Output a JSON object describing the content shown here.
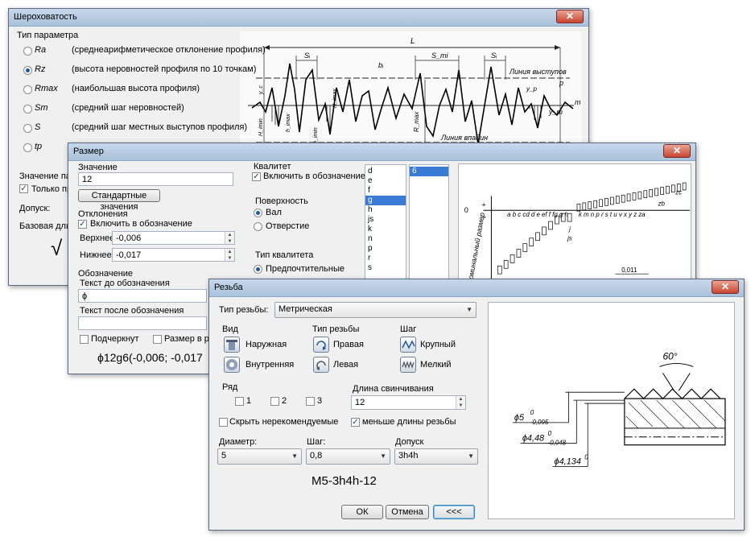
{
  "roughness": {
    "title": "Шероховатость",
    "section_label": "Тип параметра",
    "params": [
      {
        "code": "Ra",
        "desc": "(среднеарифметическое отклонение профиля)",
        "selected": false
      },
      {
        "code": "Rz",
        "desc": "(высота неровностей профиля по 10 точкам)",
        "selected": true
      },
      {
        "code": "Rmax",
        "desc": "(наибольшая высота профиля)",
        "selected": false
      },
      {
        "code": "Sm",
        "desc": "(средний шаг неровностей)",
        "selected": false
      },
      {
        "code": "S",
        "desc": "(средний шаг местных выступов профиля)",
        "selected": false
      },
      {
        "code": "tp",
        "desc": "",
        "selected": false
      }
    ],
    "value_label": "Значение пара",
    "only_label": "Только пред",
    "tolerance_label": "Допуск:",
    "base_length_label": "Базовая длина",
    "check_symbol": "√",
    "diagram": {
      "L": "L",
      "S_i_left": "Sᵢ",
      "S_i_right": "Sᵢ",
      "b_i": "bᵢ",
      "S_mi": "S_mi",
      "peak_line": "Линия выступов",
      "valley_line": "Линия впадин",
      "p": "p",
      "m": "m",
      "y_m": "y_m",
      "y_p": "y_p",
      "R_max": "R_max",
      "y_c": "y_c",
      "H_max": "H_imax",
      "H_min": "H_imin",
      "h_max": "h_imax",
      "h_min": "h_imin"
    }
  },
  "size": {
    "title": "Размер",
    "value_label": "Значение",
    "value": "12",
    "standard_values_btn": "Стандартные значения",
    "deviations_label": "Отклонения",
    "include_in_designation": "Включить в обозначение",
    "upper_label": "Верхнее",
    "upper_value": "-0,006",
    "lower_label": "Нижнее",
    "lower_value": "-0,017",
    "designation_label": "Обозначение",
    "text_before_label": "Текст до обозначения",
    "text_before_value": "ϕ",
    "text_after_label": "Текст после обозначения",
    "underlined_label": "Подчеркнут",
    "frame_label": "Размер в рамк",
    "result": "ϕ12g6(-0,006; -0,017",
    "qualitet_label": "Квалитет",
    "qualitet_include": "Включить в обозначение",
    "surface_label": "Поверхность",
    "shaft_label": "Вал",
    "hole_label": "Отверстие",
    "qualitet_type_label": "Тип квалитета",
    "preferred_label": "Предпочтительные",
    "letters": [
      "d",
      "e",
      "f",
      "g",
      "h",
      "js",
      "k",
      "n",
      "p",
      "r",
      "s"
    ],
    "letters_selected": "g",
    "grades": [
      "6"
    ],
    "grade_selected": "6",
    "chart": {
      "zero": "0",
      "plus": "+",
      "minus": "−",
      "axis_label": "номинальный размер",
      "letters_top": "a b c cd d e ef f fg g h",
      "letters_mid": "k m n p r s t u v x y z za",
      "zb": "zb",
      "zc": "zc",
      "j": "j",
      "js": "js",
      "value_label": "0,011"
    }
  },
  "thread": {
    "title": "Резьба",
    "type_label": "Тип резьбы:",
    "type_value": "Метрическая",
    "view_label": "Вид",
    "outer_label": "Наружная",
    "inner_label": "Внутренняя",
    "thread_type_label": "Тип резьбы",
    "right_label": "Правая",
    "left_label": "Левая",
    "pitch_group_label": "Шаг",
    "coarse_label": "Крупный",
    "fine_label": "Мелкий",
    "row_label": "Ряд",
    "rows": [
      "1",
      "2",
      "3"
    ],
    "length_label": "Длина свинчивания",
    "length_value": "12",
    "hide_label": "Скрыть нерекомендуемые",
    "less_label": "меньше длины резьбы",
    "diameter_label": "Диаметр:",
    "diameter_value": "5",
    "pitch_label": "Шаг:",
    "pitch_value": "0,8",
    "tolerance_label": "Допуск",
    "tolerance_value": "3h4h",
    "result": "M5-3h4h-12",
    "ok": "ОК",
    "cancel": "Отмена",
    "back": "<<<",
    "drawing": {
      "angle": "60°",
      "d1_main": "ϕ5",
      "d1_sup": "0",
      "d1_sub": "-0,095",
      "d2_main": "ϕ4,48",
      "d2_sup": "0",
      "d2_sub": "-0,048",
      "d3_main": "ϕ4,134",
      "d3_sup": "0"
    }
  }
}
